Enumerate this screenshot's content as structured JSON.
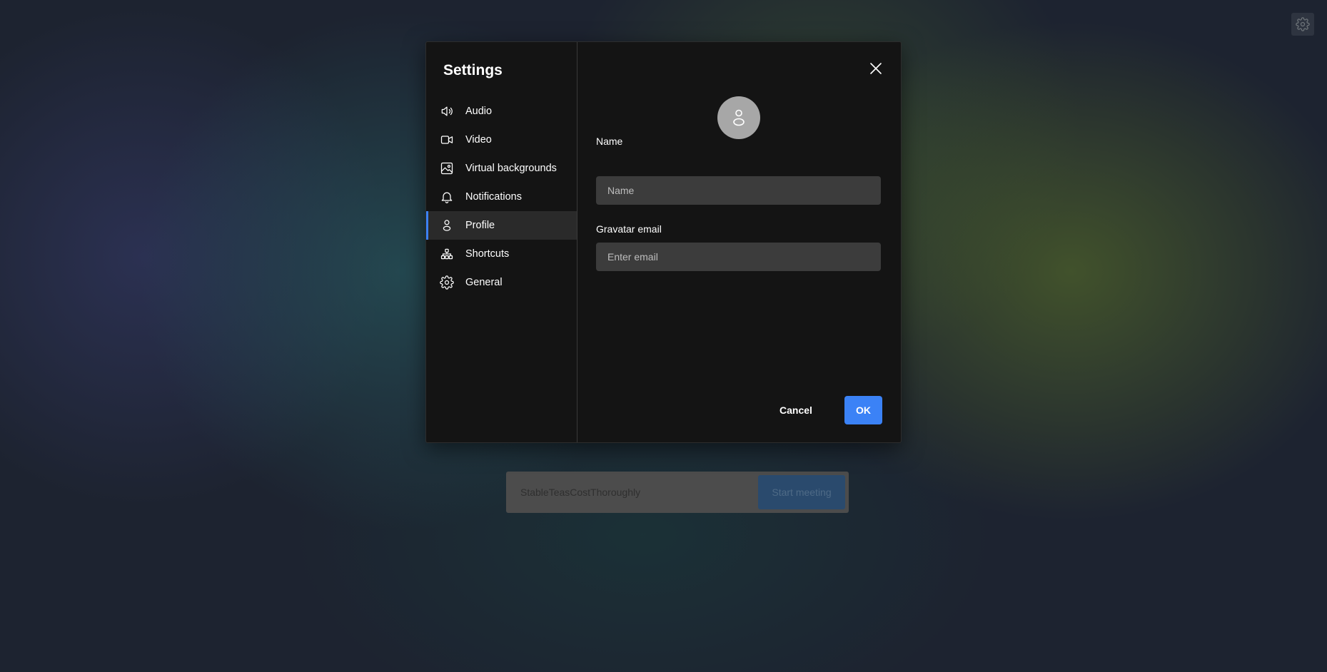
{
  "settings": {
    "title": "Settings",
    "nav": [
      {
        "label": "Audio",
        "icon": "speaker-icon",
        "active": false
      },
      {
        "label": "Video",
        "icon": "video-camera-icon",
        "active": false
      },
      {
        "label": "Virtual backgrounds",
        "icon": "image-icon",
        "active": false
      },
      {
        "label": "Notifications",
        "icon": "bell-icon",
        "active": false
      },
      {
        "label": "Profile",
        "icon": "user-icon",
        "active": true
      },
      {
        "label": "Shortcuts",
        "icon": "shortcuts-icon",
        "active": false
      },
      {
        "label": "General",
        "icon": "gear-icon",
        "active": false
      }
    ],
    "profile": {
      "name_label": "Name",
      "name_placeholder": "Name",
      "name_value": "",
      "email_label": "Gravatar email",
      "email_placeholder": "Enter email",
      "email_value": ""
    },
    "cancel_label": "Cancel",
    "ok_label": "OK"
  },
  "meeting": {
    "room_name": "StableTeasCostThoroughly",
    "start_label": "Start meeting"
  },
  "colors": {
    "accent": "#3b82f6",
    "dialog_bg": "#141414",
    "input_bg": "#3c3c3c"
  }
}
